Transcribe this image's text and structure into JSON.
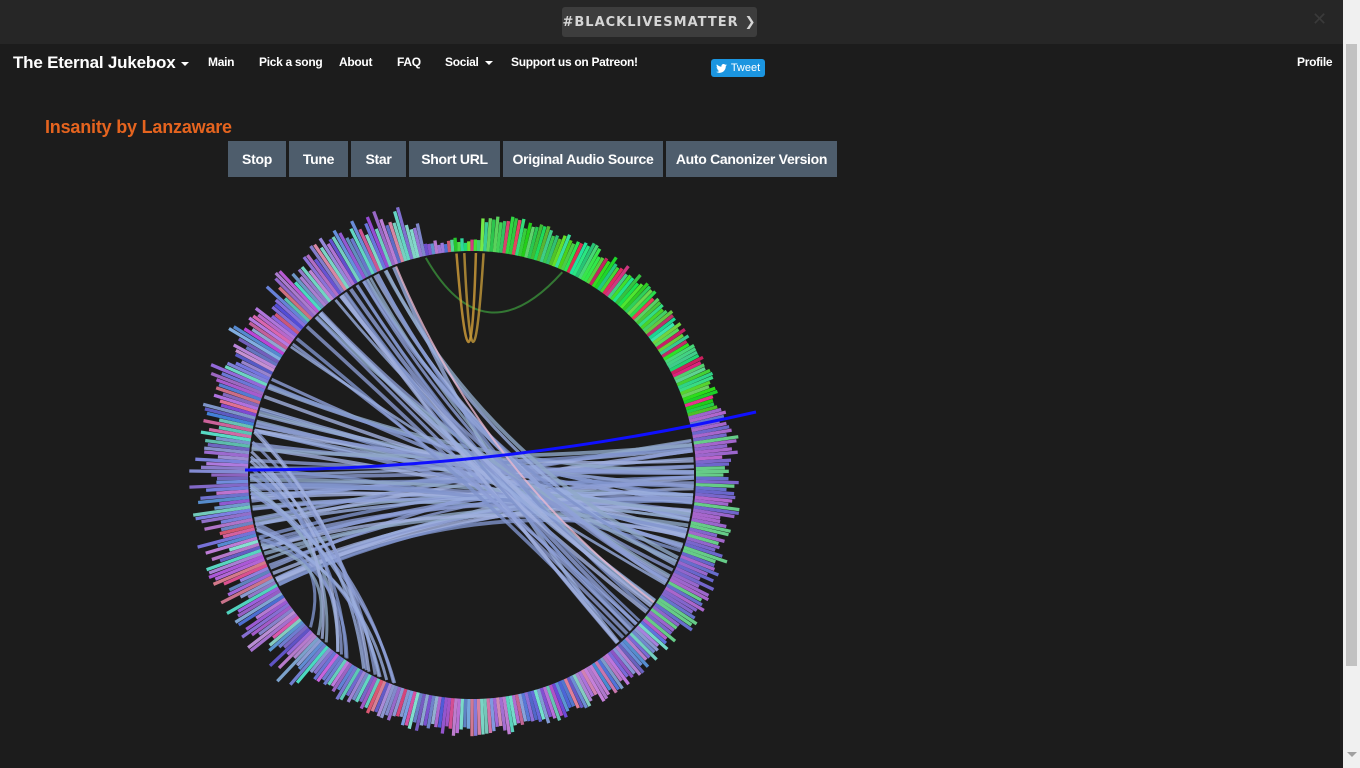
{
  "banner": {
    "blm_label": "#BLACKLIVESMATTER",
    "chevron_icon": "chevron-right-icon",
    "close_icon": "close-icon"
  },
  "navbar": {
    "brand": "The Eternal Jukebox",
    "links": [
      "Main",
      "Pick a song",
      "About",
      "FAQ",
      "Social",
      "Support us on Patreon!"
    ],
    "tweet_label": "Tweet",
    "profile": "Profile"
  },
  "song": {
    "title": "Insanity by Lanzaware"
  },
  "controls": [
    "Stop",
    "Tune",
    "Star",
    "Short URL",
    "Original Audio Source",
    "Auto Canonizer Version"
  ],
  "colors": {
    "accent": "#e5641f",
    "button_bg": "#4e5d6c",
    "current_jump": "#1010ff",
    "twitter": "#1b95e0"
  }
}
